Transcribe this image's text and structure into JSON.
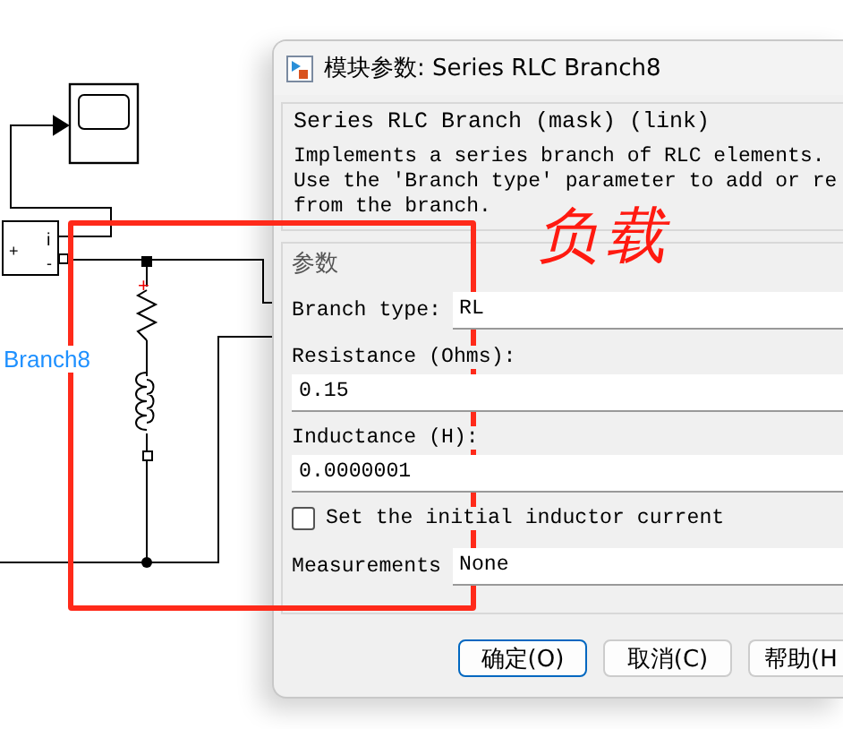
{
  "canvas": {
    "block_label": "Branch8",
    "measurement_block": {
      "output": "i",
      "plus": "+",
      "minus": "-"
    },
    "polarity_mark": "+"
  },
  "dialog": {
    "title": "模块参数: Series RLC Branch8",
    "mask_title": "Series RLC Branch (mask) (link)",
    "description": [
      "Implements a series branch of RLC elements.",
      "Use the 'Branch type' parameter to add or re",
      "from the branch."
    ],
    "section": "参数",
    "params": [
      {
        "kind": "dropdown",
        "label": "Branch type:",
        "value": "RL"
      },
      {
        "kind": "field",
        "label": "Resistance (Ohms):",
        "value": "0.15"
      },
      {
        "kind": "field",
        "label": "Inductance (H):",
        "value": "0.0000001"
      },
      {
        "kind": "checkbox",
        "label": "Set the initial inductor current",
        "checked": false
      },
      {
        "kind": "dropdown",
        "label": "Measurements",
        "value": "None"
      }
    ],
    "buttons": [
      {
        "label": "确定(O)",
        "default": true
      },
      {
        "label": "取消(C)",
        "default": false
      },
      {
        "label": "帮助(H",
        "default": false
      }
    ]
  },
  "annotation": {
    "text": "负载"
  }
}
